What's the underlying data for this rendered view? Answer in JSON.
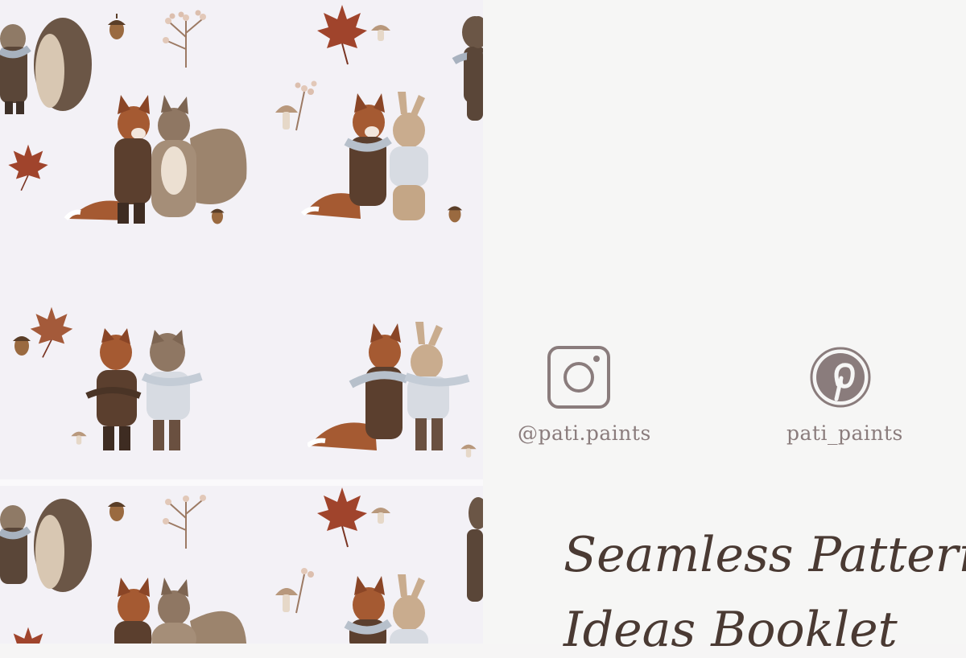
{
  "social": {
    "instagram": {
      "icon": "instagram-icon",
      "handle": "@pati.paints"
    },
    "pinterest": {
      "icon": "pinterest-icon",
      "handle": "pati_paints"
    }
  },
  "title": {
    "line1": "Seamless Pattern",
    "line2": "Ideas Booklet"
  },
  "colors": {
    "pattern_background": "#f3f1f6",
    "page_background": "#f6f6f5",
    "icon_color": "#8a7c7c",
    "title_color": "#4a3a33",
    "fox": "#a55a32",
    "maple_leaf": "#a0442c"
  },
  "pattern": {
    "motifs": [
      "hedgehog-pair",
      "fox-squirrel-pair",
      "fox-bunny-pair",
      "fox-hedgehog-pair",
      "maple-leaf",
      "acorn",
      "mushroom",
      "berry-sprig"
    ]
  }
}
